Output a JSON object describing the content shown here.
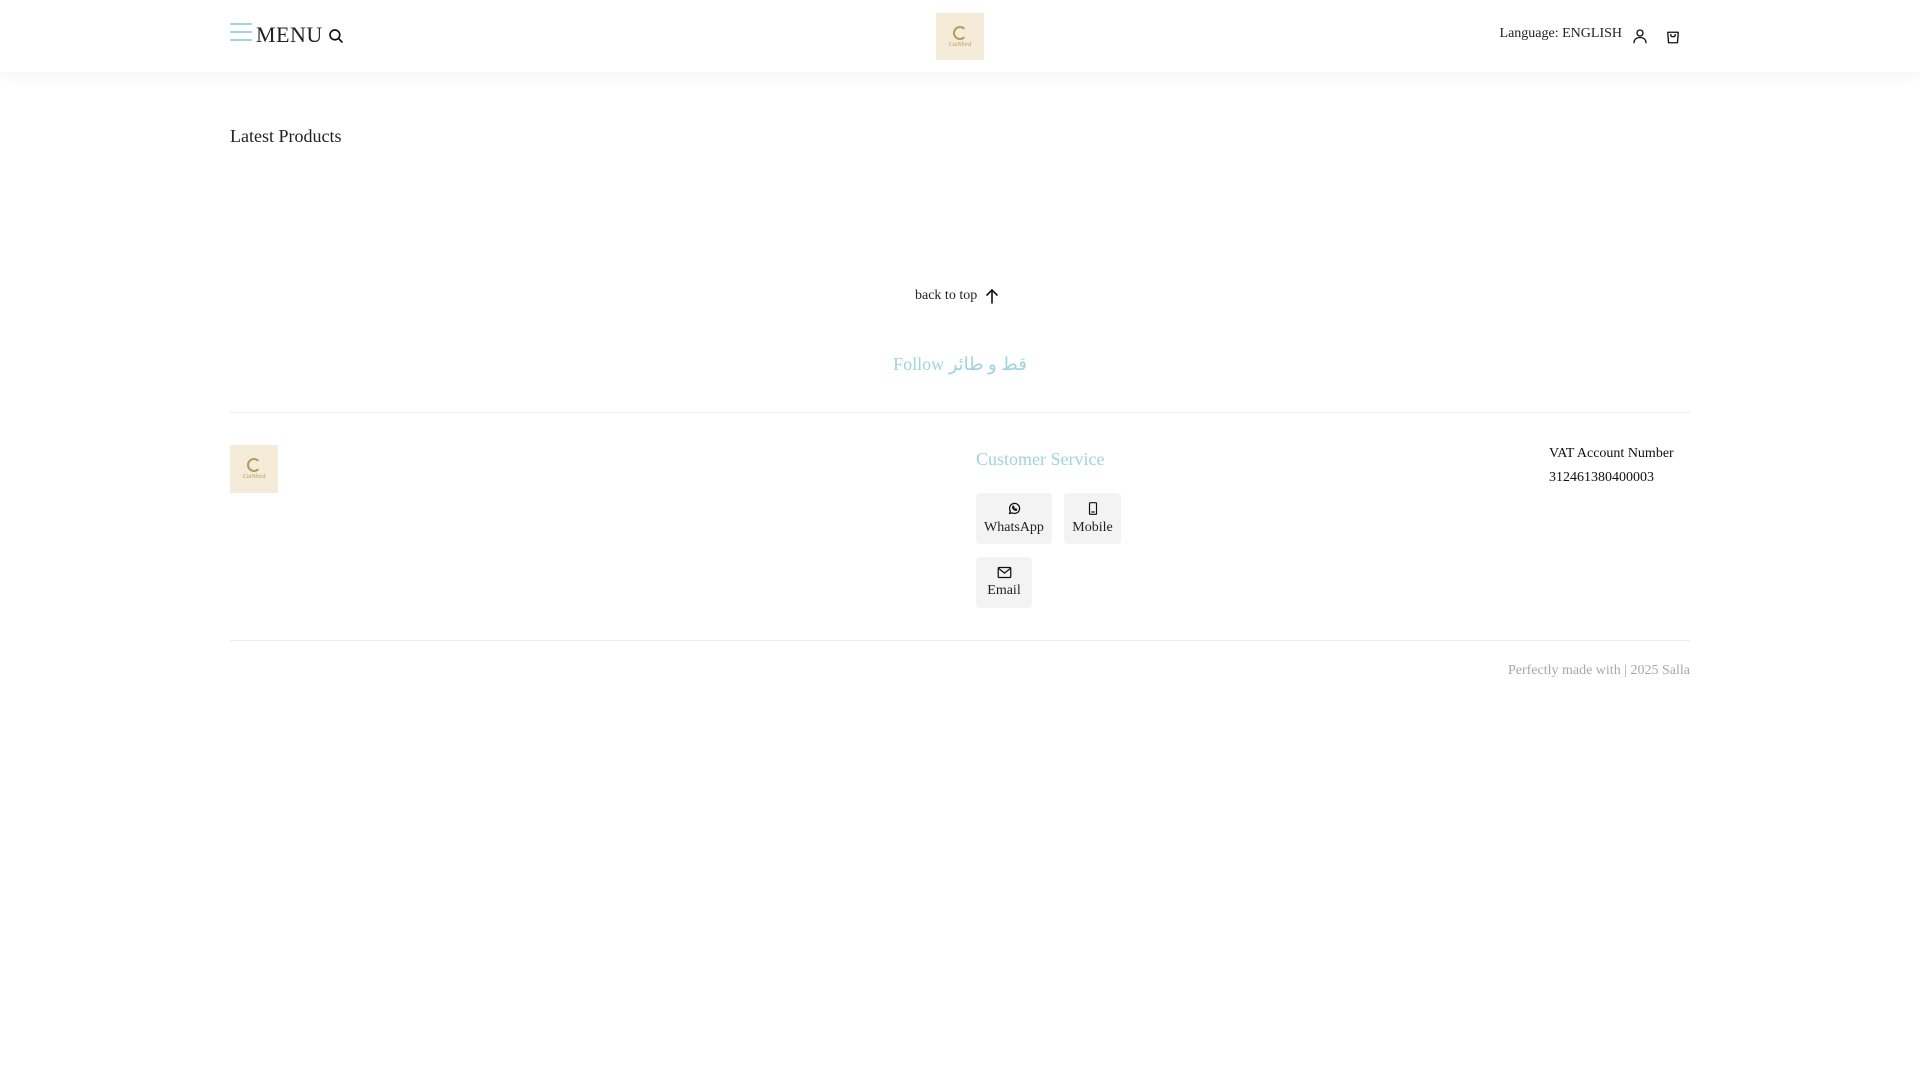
{
  "header": {
    "menu_label": "MENU",
    "language_label": "Language: ENGLISH",
    "logo_text": "CatNbird",
    "icons": {
      "menu": "hamburger-icon",
      "search": "search-icon",
      "user": "user-icon",
      "cart": "shopping-bag-icon"
    }
  },
  "main": {
    "section_title": "Latest Products",
    "back_to_top": "back to top"
  },
  "footer": {
    "follow_text": "Follow قط و طائر",
    "logo_text": "CatNbird",
    "customer_service_title": "Customer Service",
    "contacts": {
      "whatsapp": "WhatsApp",
      "mobile": "Mobile",
      "email": "Email"
    },
    "vat_label": "VAT Account Number",
    "vat_number": "312461380400003",
    "copyright": "Perfectly made with | 2025 Salla"
  },
  "colors": {
    "accent": "#9fd3df",
    "logo_bg": "#f4ecd9",
    "button_bg": "#f3f3f3",
    "muted_text": "#a8a8a8"
  }
}
